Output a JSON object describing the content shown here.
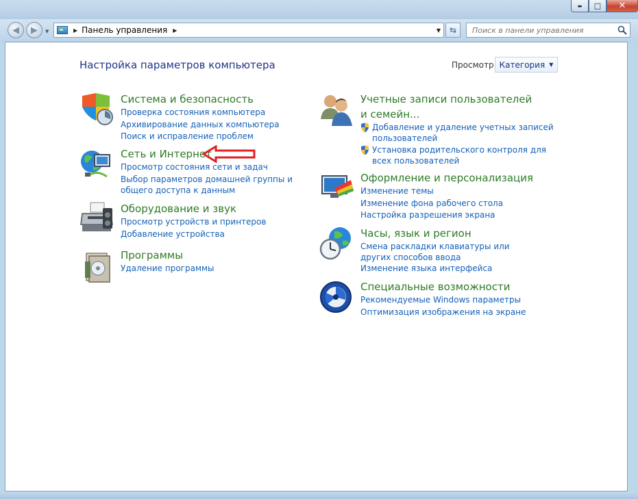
{
  "window": {
    "caption_buttons": {
      "minimize": "▬",
      "maximize": "□",
      "close": "✕"
    }
  },
  "nav": {
    "breadcrumb": "Панель управления",
    "search_placeholder": "Поиск в панели управления"
  },
  "header": {
    "title": "Настройка параметров компьютера",
    "view_by_label": "Просмотр:",
    "view_by_value": "Категория"
  },
  "categories": {
    "system": {
      "title": "Система и безопасность",
      "icon": "shield-icon",
      "links": [
        "Проверка состояния компьютера",
        "Архивирование данных компьютера",
        "Поиск и исправление проблем"
      ]
    },
    "network": {
      "title": "Сеть и Интернет",
      "icon": "network-globe-icon",
      "links": [
        "Просмотр состояния сети и задач",
        "Выбор параметров домашней группы и общего доступа к данным"
      ]
    },
    "hardware": {
      "title": "Оборудование и звук",
      "icon": "printer-icon",
      "links": [
        "Просмотр устройств и принтеров",
        "Добавление устройства"
      ]
    },
    "programs": {
      "title": "Программы",
      "icon": "programs-box-icon",
      "links": [
        "Удаление программы"
      ]
    },
    "users": {
      "title": "Учетные записи пользователей и семейн...",
      "icon": "users-icon",
      "links": [
        "Добавление и удаление учетных записей пользователей",
        "Установка родительского контроля для всех пользователей"
      ]
    },
    "appearance": {
      "title": "Оформление и персонализация",
      "icon": "monitor-palette-icon",
      "links": [
        "Изменение темы",
        "Изменение фона рабочего стола",
        "Настройка разрешения экрана"
      ]
    },
    "clock": {
      "title": "Часы, язык и регион",
      "icon": "clock-globe-icon",
      "links": [
        "Смена раскладки клавиатуры или других способов ввода",
        "Изменение языка интерфейса"
      ]
    },
    "access": {
      "title": "Специальные возможности",
      "icon": "accessibility-icon",
      "links": [
        "Рекомендуемые Windows параметры",
        "Оптимизация изображения на экране"
      ]
    }
  },
  "colors": {
    "category_title": "#2e7a27",
    "link": "#1360b7",
    "page_title": "#1e3287",
    "annotation_arrow": "#e02020"
  }
}
